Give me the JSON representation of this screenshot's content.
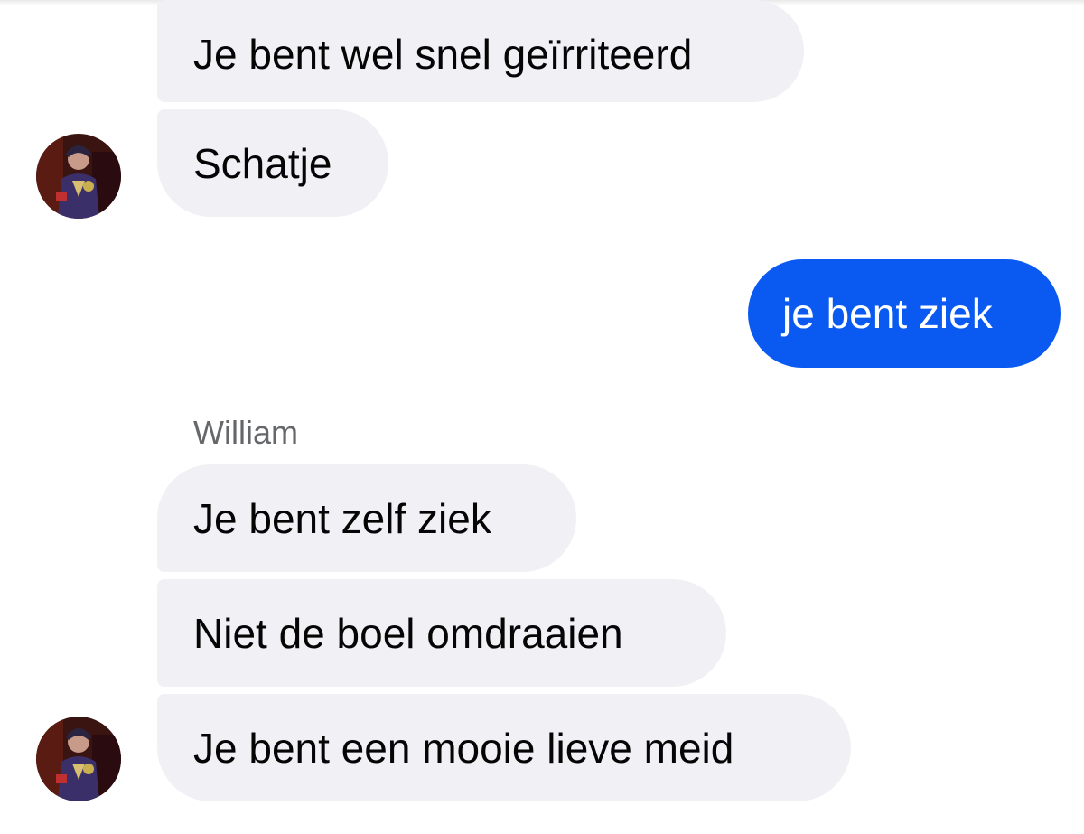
{
  "conversation": {
    "messages": [
      {
        "direction": "incoming",
        "text": "Je bent wel snel geïrriteerd"
      },
      {
        "direction": "incoming",
        "text": "Schatje"
      },
      {
        "direction": "outgoing",
        "text": "je bent ziek"
      },
      {
        "direction": "incoming",
        "text": "Je bent zelf ziek"
      },
      {
        "direction": "incoming",
        "text": "Niet de boel omdraaien"
      },
      {
        "direction": "incoming",
        "text": "Je bent een mooie lieve meid"
      }
    ],
    "sender_name": "William"
  },
  "colors": {
    "incoming_bubble": "#f1f1f5",
    "outgoing_bubble": "#0a5af1",
    "sender_label": "#65676b"
  },
  "icons": {
    "avatar": "contact-avatar-icon"
  }
}
